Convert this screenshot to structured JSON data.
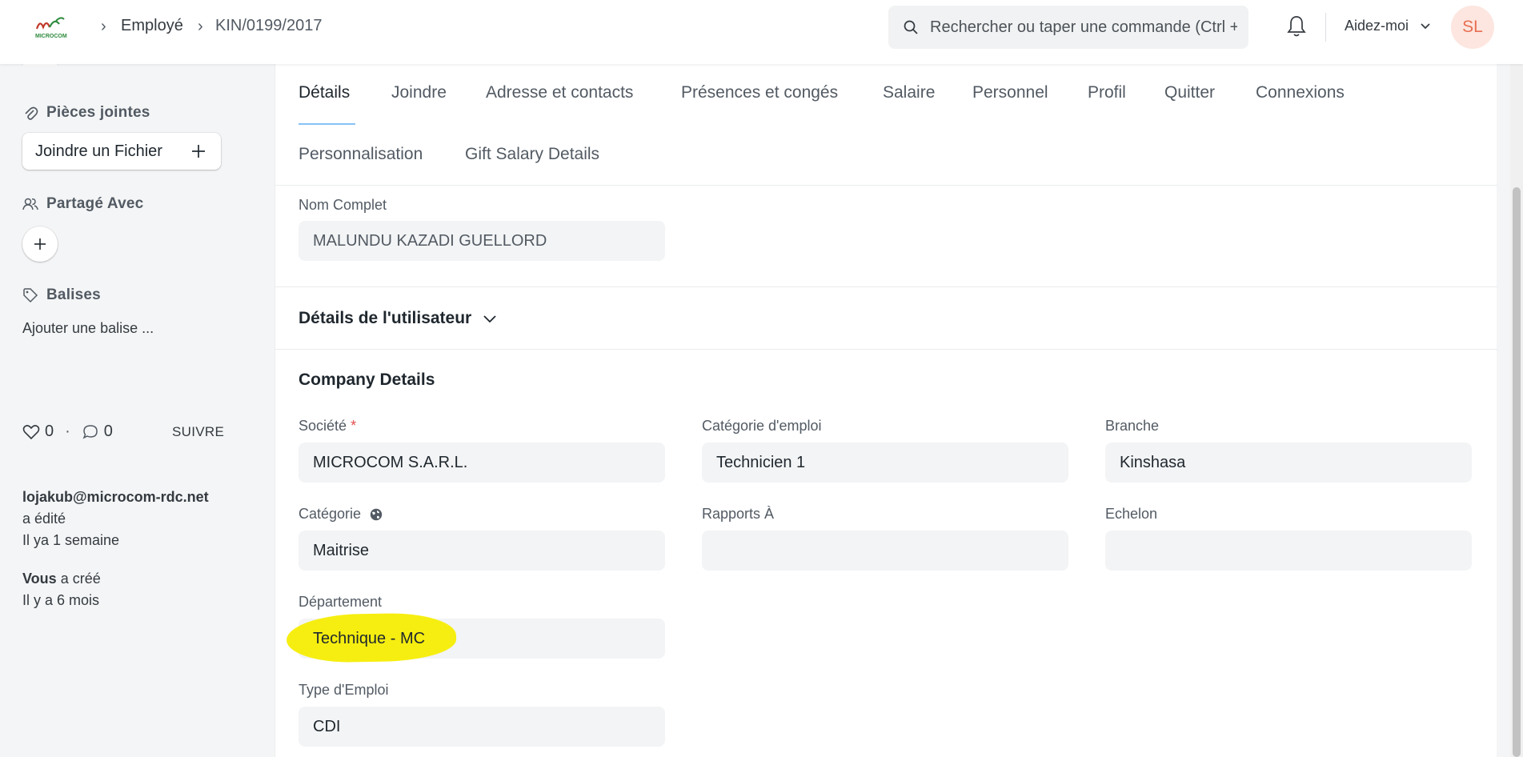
{
  "header": {
    "logo_text": "MICROCOM",
    "breadcrumbs": [
      "Employé",
      "KIN/0199/2017"
    ],
    "search_placeholder": "Rechercher ou taper une commande (Ctrl + G)",
    "help_label": "Aidez-moi",
    "avatar_initials": "SL"
  },
  "sidebar": {
    "attachments_heading": "Pièces jointes",
    "attach_button": "Joindre un Fichier",
    "shared_heading": "Partagé Avec",
    "tags_heading": "Balises",
    "add_tag": "Ajouter une balise ...",
    "likes": "0",
    "dot": "·",
    "comments": "0",
    "follow": "SUIVRE",
    "activity": [
      {
        "actor": "lojakub@microcom-rdc.net",
        "action": "a édité",
        "time": "Il ya 1 semaine"
      },
      {
        "actor": "Vous",
        "action": "a créé",
        "time": "Il y a 6 mois"
      }
    ]
  },
  "tabs": [
    "Détails",
    "Joindre",
    "Adresse et contacts",
    "Présences et congés",
    "Salaire",
    "Personnel",
    "Profil",
    "Quitter",
    "Connexions",
    "Personnalisation",
    "Gift Salary Details"
  ],
  "form": {
    "full_name": {
      "label": "Nom Complet",
      "value": "MALUNDU KAZADI GUELLORD"
    },
    "user_details_title": "Détails de l'utilisateur",
    "company_details_title": "Company Details",
    "company": {
      "label": "Société",
      "required_mark": "*",
      "value": "MICROCOM S.A.R.L."
    },
    "job_category": {
      "label": "Catégorie d'emploi",
      "value": "Technicien 1"
    },
    "branch": {
      "label": "Branche",
      "value": "Kinshasa"
    },
    "category": {
      "label": "Catégorie",
      "value": "Maitrise"
    },
    "reports_to": {
      "label": "Rapports À",
      "value": ""
    },
    "echelon": {
      "label": "Echelon",
      "value": ""
    },
    "department": {
      "label": "Département",
      "value": "Technique - MC"
    },
    "employment_type": {
      "label": "Type d'Emploi",
      "value": "CDI"
    }
  },
  "colors": {
    "highlight": "#f6ee10",
    "active_tab_underline": "#2490ef",
    "avatar_bg": "#fde6e0",
    "avatar_text": "#e76f51"
  }
}
